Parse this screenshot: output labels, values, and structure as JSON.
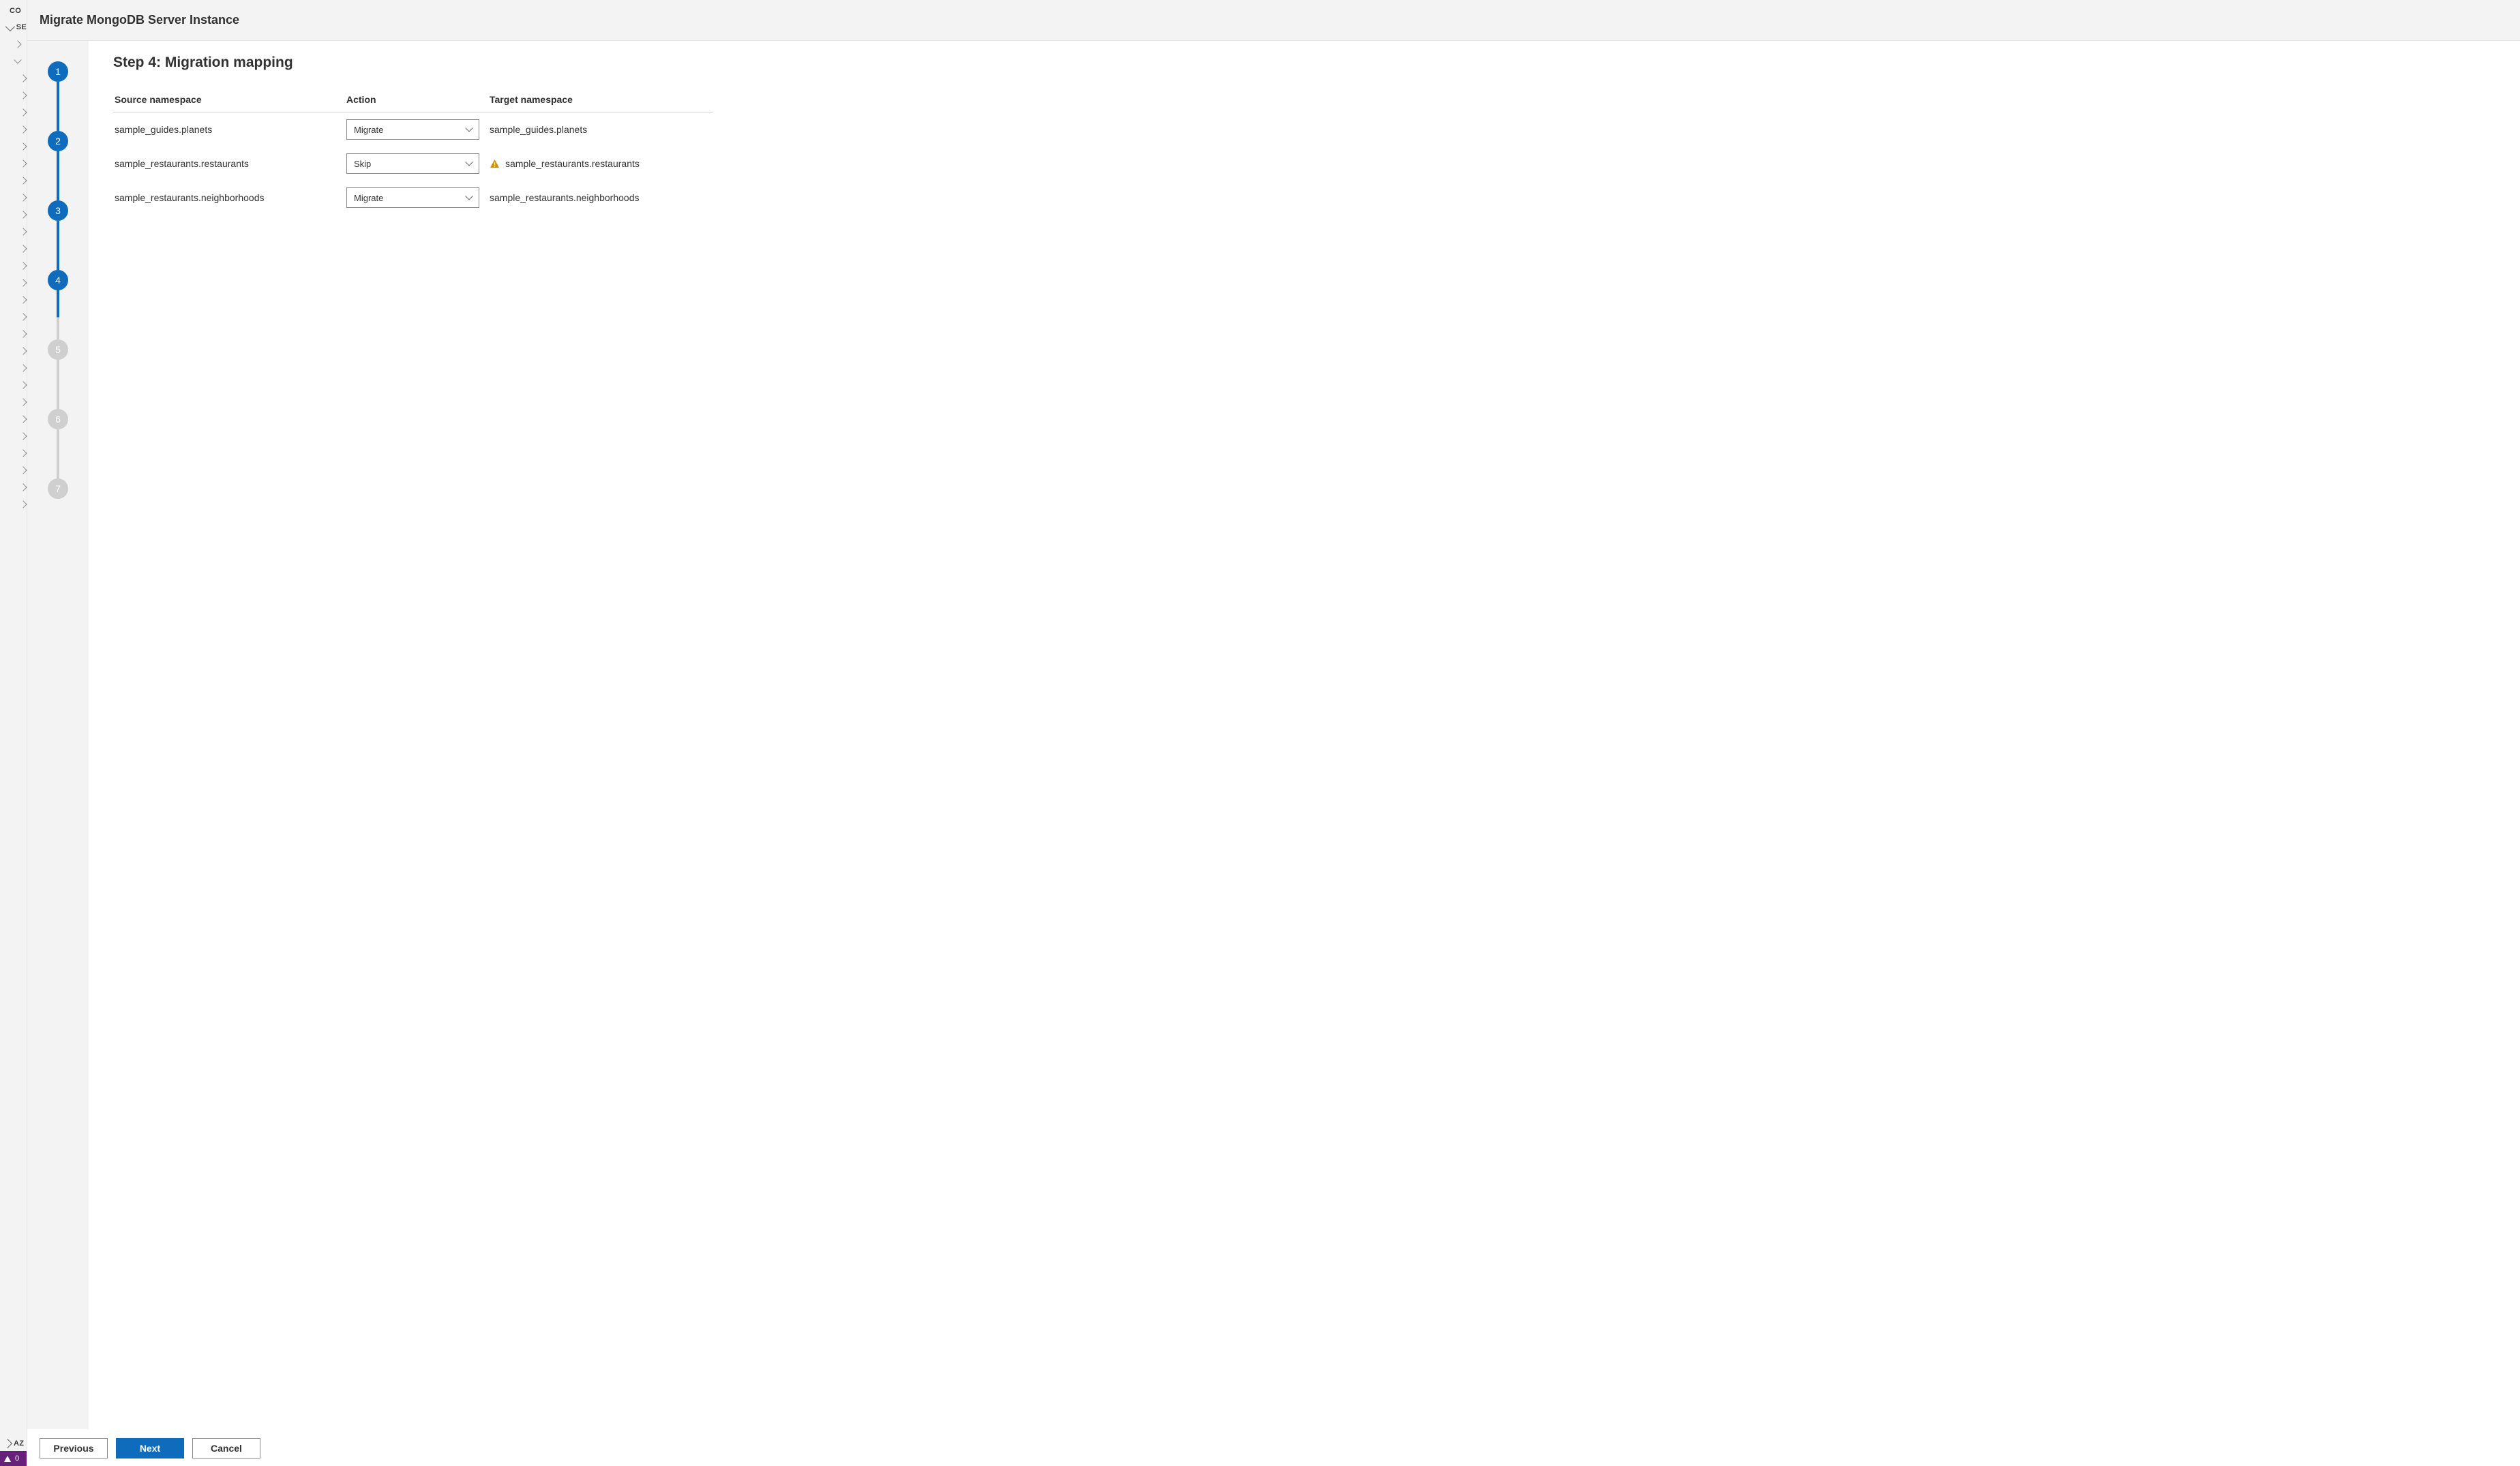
{
  "sidebar": {
    "top_label_1": "CO",
    "section_label": "SE",
    "bottom_label": "AZ",
    "status_count": "0"
  },
  "titlebar": {
    "title": "Migrate MongoDB Server Instance"
  },
  "stepper": {
    "steps": [
      "1",
      "2",
      "3",
      "4",
      "5",
      "6",
      "7"
    ],
    "current_index": 3
  },
  "content": {
    "heading": "Step 4: Migration mapping",
    "columns": {
      "source": "Source namespace",
      "action": "Action",
      "target": "Target namespace"
    },
    "rows": [
      {
        "source": "sample_guides.planets",
        "action": "Migrate",
        "target": "sample_guides.planets",
        "warning": false
      },
      {
        "source": "sample_restaurants.restaurants",
        "action": "Skip",
        "target": "sample_restaurants.restaurants",
        "warning": true
      },
      {
        "source": "sample_restaurants.neighborhoods",
        "action": "Migrate",
        "target": "sample_restaurants.neighborhoods",
        "warning": false
      }
    ]
  },
  "footer": {
    "previous": "Previous",
    "next": "Next",
    "cancel": "Cancel"
  }
}
